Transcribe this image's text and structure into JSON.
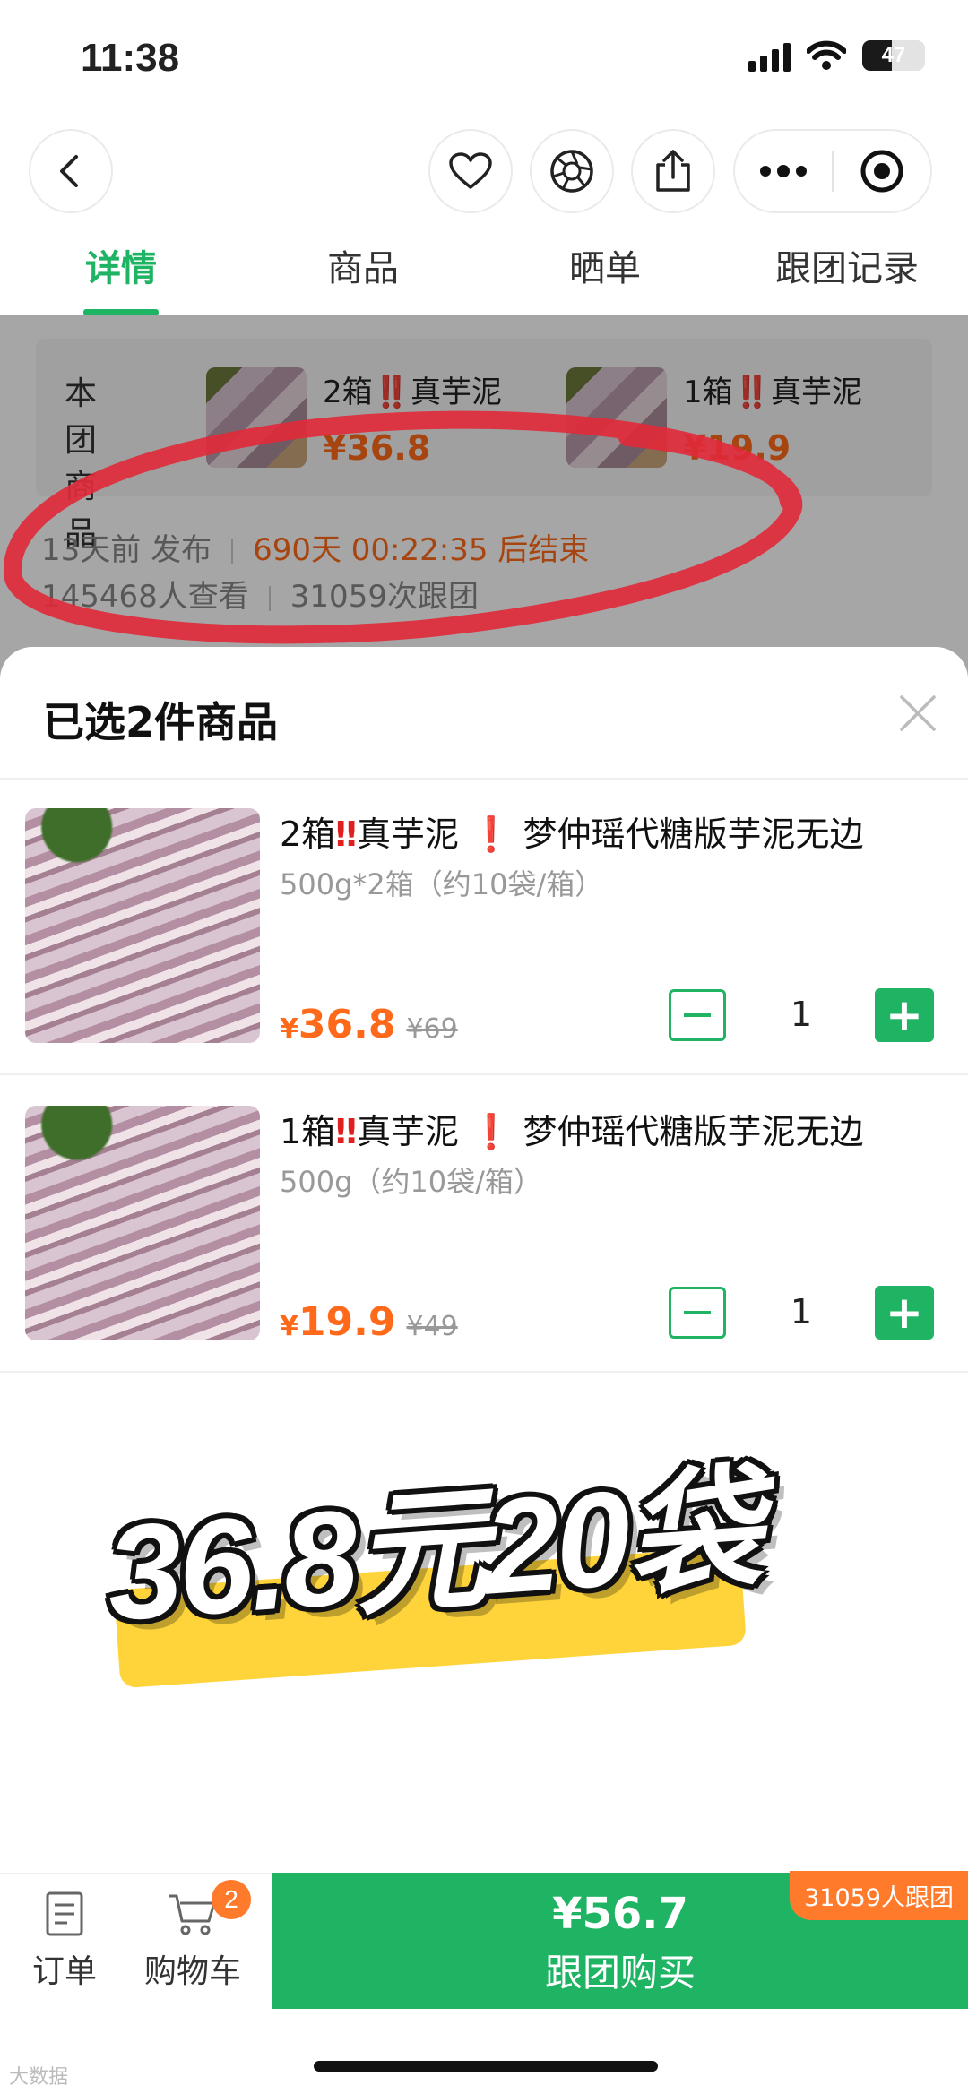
{
  "status_bar": {
    "time": "11:38",
    "battery": "47",
    "battery_level": 0.47
  },
  "nav": {
    "back_icon": "chevron-left-icon",
    "actions": [
      "heart-icon",
      "shutter-icon",
      "share-icon"
    ],
    "capsule": [
      "more-dots-icon",
      "target-icon"
    ]
  },
  "tabs": [
    {
      "label": "详情",
      "active": true
    },
    {
      "label": "商品",
      "active": false
    },
    {
      "label": "晒单",
      "active": false
    },
    {
      "label": "跟团记录",
      "active": false
    }
  ],
  "group_info": {
    "label": "本团商品",
    "products": [
      {
        "name": "2箱‼️真芋泥",
        "price": "¥36.8"
      },
      {
        "name": "1箱‼️真芋泥",
        "price": "¥19.9"
      }
    ],
    "published": "13天前 发布",
    "countdown": "690天 00:22:35 后结束",
    "views": "145468人查看",
    "joins": "31059次跟团"
  },
  "sheet": {
    "title": "已选2件商品",
    "items": [
      {
        "name_a": "2箱",
        "bang_a": "‼",
        "name_b": "真芋泥",
        "bang_b": "❗",
        "name_c": "梦仲瑶代糖版芋泥无边",
        "spec": "500g*2箱（约10袋/箱）",
        "currency": "¥",
        "price": "36.8",
        "original": "¥69",
        "qty": "1"
      },
      {
        "name_a": "1箱",
        "bang_a": "‼",
        "name_b": "真芋泥",
        "bang_b": "❗",
        "name_c": "梦仲瑶代糖版芋泥无边",
        "spec": "500g（约10袋/箱）",
        "currency": "¥",
        "price": "19.9",
        "original": "¥49",
        "qty": "1"
      }
    ]
  },
  "promo": {
    "text": "36.8元20袋",
    "highlight_color": "#ffd43b"
  },
  "bottom_bar": {
    "orders_label": "订单",
    "cart_label": "购物车",
    "cart_count": "2",
    "buy_price": "¥56.7",
    "buy_label": "跟团购买",
    "group_tag": "31059人跟团"
  },
  "watermark": "大数据",
  "colors": {
    "accent": "#1fb463",
    "price": "#ff6a1a",
    "marker": "#e02a3a"
  }
}
